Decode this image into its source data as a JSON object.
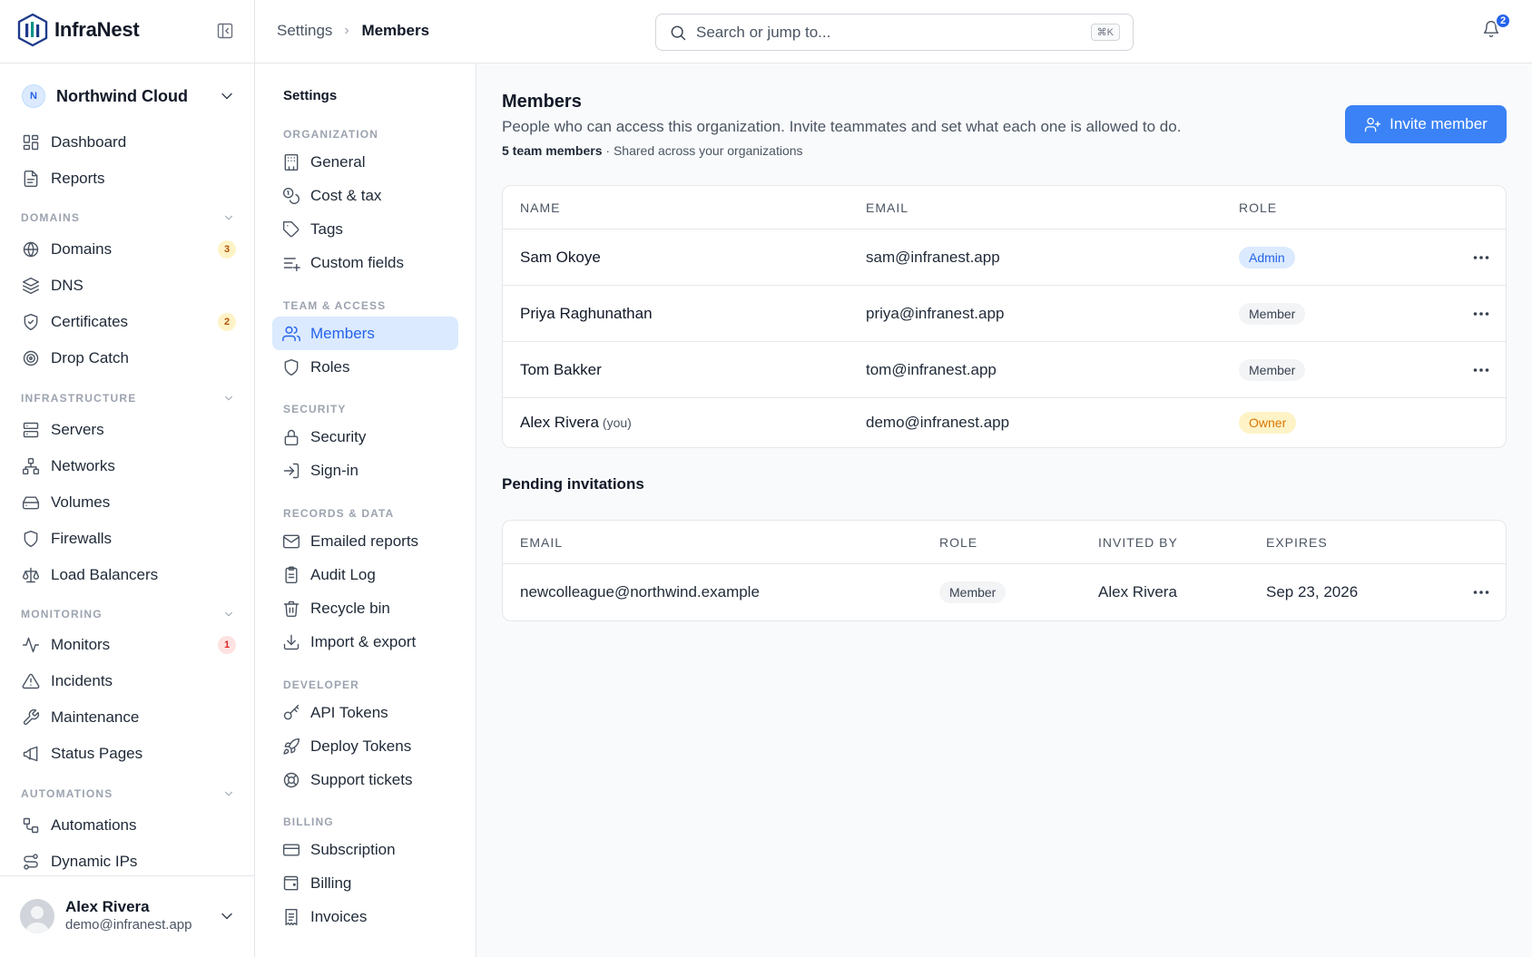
{
  "app": {
    "name": "InfraNest",
    "colors": {
      "accent": "#3b82f6",
      "accent_bg": "#dbeafe",
      "amber": "#d97706",
      "red": "#dc2626"
    }
  },
  "sidebar": {
    "org_initial": "N",
    "org_name": "Northwind Cloud",
    "top_items": [
      {
        "label": "Dashboard",
        "icon": "dashboard-icon"
      },
      {
        "label": "Reports",
        "icon": "reports-icon"
      }
    ],
    "sections": [
      {
        "label": "DOMAINS",
        "items": [
          {
            "label": "Domains",
            "icon": "globe-icon",
            "badge": "3"
          },
          {
            "label": "DNS",
            "icon": "layers-icon"
          },
          {
            "label": "Certificates",
            "icon": "shield-check-icon",
            "badge": "2"
          },
          {
            "label": "Drop Catch",
            "icon": "target-icon"
          }
        ]
      },
      {
        "label": "INFRASTRUCTURE",
        "items": [
          {
            "label": "Servers",
            "icon": "server-icon"
          },
          {
            "label": "Networks",
            "icon": "network-icon"
          },
          {
            "label": "Volumes",
            "icon": "drive-icon"
          },
          {
            "label": "Firewalls",
            "icon": "shield-icon"
          },
          {
            "label": "Load Balancers",
            "icon": "scale-icon"
          }
        ]
      },
      {
        "label": "MONITORING",
        "items": [
          {
            "label": "Monitors",
            "icon": "activity-icon",
            "badge": "1"
          },
          {
            "label": "Incidents",
            "icon": "alert-triangle-icon"
          },
          {
            "label": "Maintenance",
            "icon": "wrench-icon"
          },
          {
            "label": "Status Pages",
            "icon": "megaphone-icon"
          }
        ]
      },
      {
        "label": "AUTOMATIONS",
        "items": [
          {
            "label": "Automations",
            "icon": "workflow-icon"
          },
          {
            "label": "Dynamic IPs",
            "icon": "route-icon"
          }
        ]
      }
    ],
    "user": {
      "name": "Alex Rivera",
      "email": "demo@infranest.app"
    }
  },
  "topbar": {
    "breadcrumb": [
      "Settings",
      "Members"
    ],
    "search_placeholder": "Search or jump to...",
    "search_shortcut": "⌘K",
    "notifications_count": "2"
  },
  "settings_nav": {
    "title": "Settings",
    "sections": [
      {
        "label": "ORGANIZATION",
        "items": [
          {
            "label": "General",
            "icon": "building-icon"
          },
          {
            "label": "Cost & tax",
            "icon": "coins-icon"
          },
          {
            "label": "Tags",
            "icon": "tag-icon"
          },
          {
            "label": "Custom fields",
            "icon": "list-plus-icon"
          }
        ]
      },
      {
        "label": "TEAM & ACCESS",
        "items": [
          {
            "label": "Members",
            "icon": "users-icon",
            "active": true
          },
          {
            "label": "Roles",
            "icon": "shield-icon"
          }
        ]
      },
      {
        "label": "SECURITY",
        "items": [
          {
            "label": "Security",
            "icon": "lock-icon"
          },
          {
            "label": "Sign-in",
            "icon": "log-in-icon"
          }
        ]
      },
      {
        "label": "RECORDS & DATA",
        "items": [
          {
            "label": "Emailed reports",
            "icon": "mail-icon"
          },
          {
            "label": "Audit Log",
            "icon": "clipboard-icon"
          },
          {
            "label": "Recycle bin",
            "icon": "trash-icon"
          },
          {
            "label": "Import & export",
            "icon": "download-icon"
          }
        ]
      },
      {
        "label": "DEVELOPER",
        "items": [
          {
            "label": "API Tokens",
            "icon": "key-icon"
          },
          {
            "label": "Deploy Tokens",
            "icon": "rocket-icon"
          },
          {
            "label": "Support tickets",
            "icon": "lifebuoy-icon"
          }
        ]
      },
      {
        "label": "BILLING",
        "items": [
          {
            "label": "Subscription",
            "icon": "credit-card-icon"
          },
          {
            "label": "Billing",
            "icon": "wallet-icon"
          },
          {
            "label": "Invoices",
            "icon": "receipt-icon"
          }
        ]
      }
    ]
  },
  "main": {
    "title": "Members",
    "description": "People who can access this organization. Invite teammates and set what each one is allowed to do.",
    "meta_count": "5 team members",
    "meta_rest": "· Shared across your organizations",
    "invite_label": "Invite member",
    "members_table": {
      "headers": [
        "NAME",
        "EMAIL",
        "ROLE"
      ],
      "rows": [
        {
          "name": "Sam Okoye",
          "suffix": "",
          "email": "sam@infranest.app",
          "role": "Admin",
          "role_style": "admin",
          "menu": true
        },
        {
          "name": "Priya Raghunathan",
          "suffix": "",
          "email": "priya@infranest.app",
          "role": "Member",
          "role_style": "member",
          "menu": true
        },
        {
          "name": "Tom Bakker",
          "suffix": "",
          "email": "tom@infranest.app",
          "role": "Member",
          "role_style": "member",
          "menu": true
        },
        {
          "name": "Alex Rivera",
          "suffix": "(you)",
          "email": "demo@infranest.app",
          "role": "Owner",
          "role_style": "owner",
          "menu": false
        }
      ]
    },
    "pending_title": "Pending invitations",
    "pending_table": {
      "headers": [
        "EMAIL",
        "ROLE",
        "INVITED BY",
        "EXPIRES"
      ],
      "rows": [
        {
          "email": "newcolleague@northwind.example",
          "role": "Member",
          "invited_by": "Alex Rivera",
          "expires": "Sep 23, 2026"
        }
      ]
    }
  }
}
